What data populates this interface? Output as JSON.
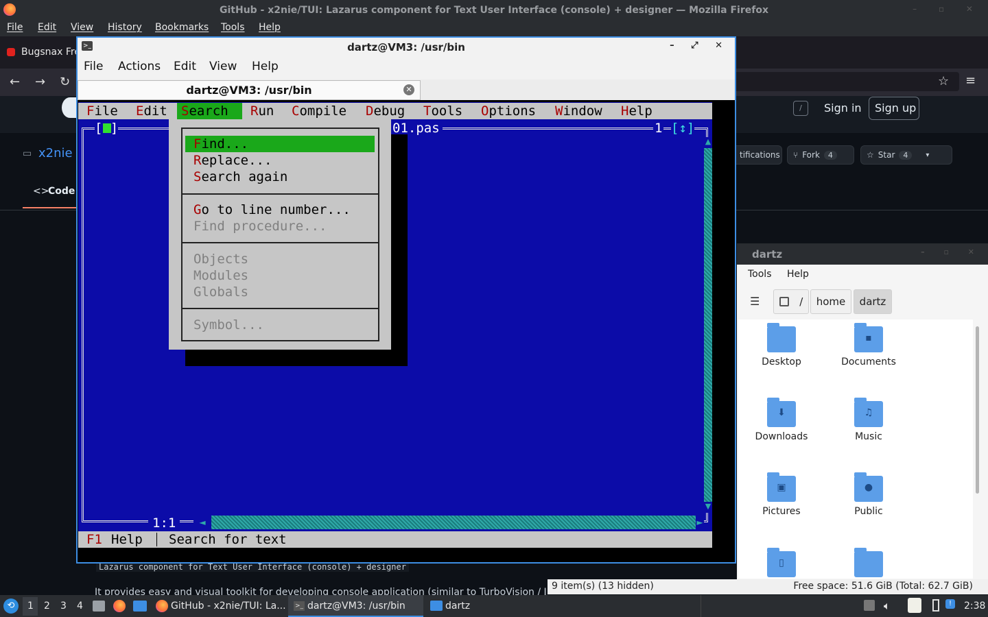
{
  "firefox": {
    "window_title": "GitHub - x2nie/TUI: Lazarus component for Text User Interface (console) + designer — Mozilla Firefox",
    "menu": [
      "File",
      "Edit",
      "View",
      "History",
      "Bookmarks",
      "Tools",
      "Help"
    ],
    "tab_label": "Bugsnax Fre"
  },
  "github": {
    "sign_in": "Sign in",
    "sign_up": "Sign up",
    "slash_key": "/",
    "notifications": "tifications",
    "fork_label": "Fork",
    "fork_count": "4",
    "star_label": "Star",
    "star_count": "4",
    "repo_owner": "x2nie /",
    "code_tab": "Code",
    "description": "Lazarus component for Text User Interface (console) + designer",
    "body_text": "It provides easy and visual toolkit for developing console application (similar to TurboVision / I"
  },
  "terminal": {
    "title": "dartz@VM3: /usr/bin",
    "menu": [
      "File",
      "Actions",
      "Edit",
      "View",
      "Help"
    ],
    "tab_title": "dartz@VM3: /usr/bin"
  },
  "tui": {
    "menu": [
      {
        "hot": "F",
        "rest": "ile"
      },
      {
        "hot": "E",
        "rest": "dit"
      },
      {
        "hot": "S",
        "rest": "earch"
      },
      {
        "hot": "R",
        "rest": "un"
      },
      {
        "hot": "C",
        "rest": "ompile"
      },
      {
        "hot": "D",
        "rest": "ebug"
      },
      {
        "hot": "T",
        "rest": "ools"
      },
      {
        "hot": "O",
        "rest": "ptions"
      },
      {
        "hot": "W",
        "rest": "indow"
      },
      {
        "hot": "H",
        "rest": "elp"
      }
    ],
    "file_name": "01.pas",
    "window_number": "1",
    "zoom_icon": "[↕]",
    "close_box": "[ ]",
    "cursor_pos": "1:1",
    "status_key": "F1",
    "status_key_label": "Help",
    "status_hint": "Search for text",
    "search_menu": [
      {
        "hot": "F",
        "rest": "ind...",
        "enabled": true,
        "selected": true
      },
      {
        "hot": "R",
        "rest": "eplace...",
        "enabled": true
      },
      {
        "hot": "S",
        "rest": "earch again",
        "enabled": true
      },
      {
        "hot": "G",
        "rest": "o to line number...",
        "enabled": true
      },
      {
        "hot": "",
        "rest": "Find procedure...",
        "enabled": false
      },
      {
        "hot": "",
        "rest": "Objects",
        "enabled": false
      },
      {
        "hot": "",
        "rest": "Modules",
        "enabled": false
      },
      {
        "hot": "",
        "rest": "Globals",
        "enabled": false
      },
      {
        "hot": "",
        "rest": "Symbol...",
        "enabled": false
      }
    ]
  },
  "file_manager": {
    "title": "dartz",
    "menu": [
      "Tools",
      "Help"
    ],
    "breadcrumb": [
      "/",
      "home",
      "dartz"
    ],
    "folders": [
      {
        "name": "Desktop",
        "icon": "desktop-folder-icon",
        "glyph": ""
      },
      {
        "name": "Documents",
        "icon": "documents-folder-icon",
        "glyph": "▪"
      },
      {
        "name": "Downloads",
        "icon": "downloads-folder-icon",
        "glyph": "⬇"
      },
      {
        "name": "Music",
        "icon": "music-folder-icon",
        "glyph": "♫"
      },
      {
        "name": "Pictures",
        "icon": "pictures-folder-icon",
        "glyph": "▣"
      },
      {
        "name": "Public",
        "icon": "public-folder-icon",
        "glyph": "●"
      },
      {
        "name": "",
        "icon": "templates-folder-icon",
        "glyph": "▯"
      },
      {
        "name": "",
        "icon": "videos-folder-icon",
        "glyph": ""
      }
    ],
    "status_items": "9 item(s) (13 hidden)",
    "status_space": "Free space: 51.6 GiB (Total: 62.7 GiB)"
  },
  "taskbar": {
    "workspaces": [
      "1",
      "2",
      "3",
      "4"
    ],
    "tasks": [
      "GitHub - x2nie/TUI: La...",
      "dartz@VM3: /usr/bin",
      "dartz"
    ],
    "clock": "2:38"
  },
  "colors": {
    "tui_blue": "#0c0ca8",
    "tui_gray": "#c6c6c6",
    "tui_green": "#1aa81a",
    "tui_hotkey": "#a80000",
    "accent": "#3d8ee3"
  }
}
